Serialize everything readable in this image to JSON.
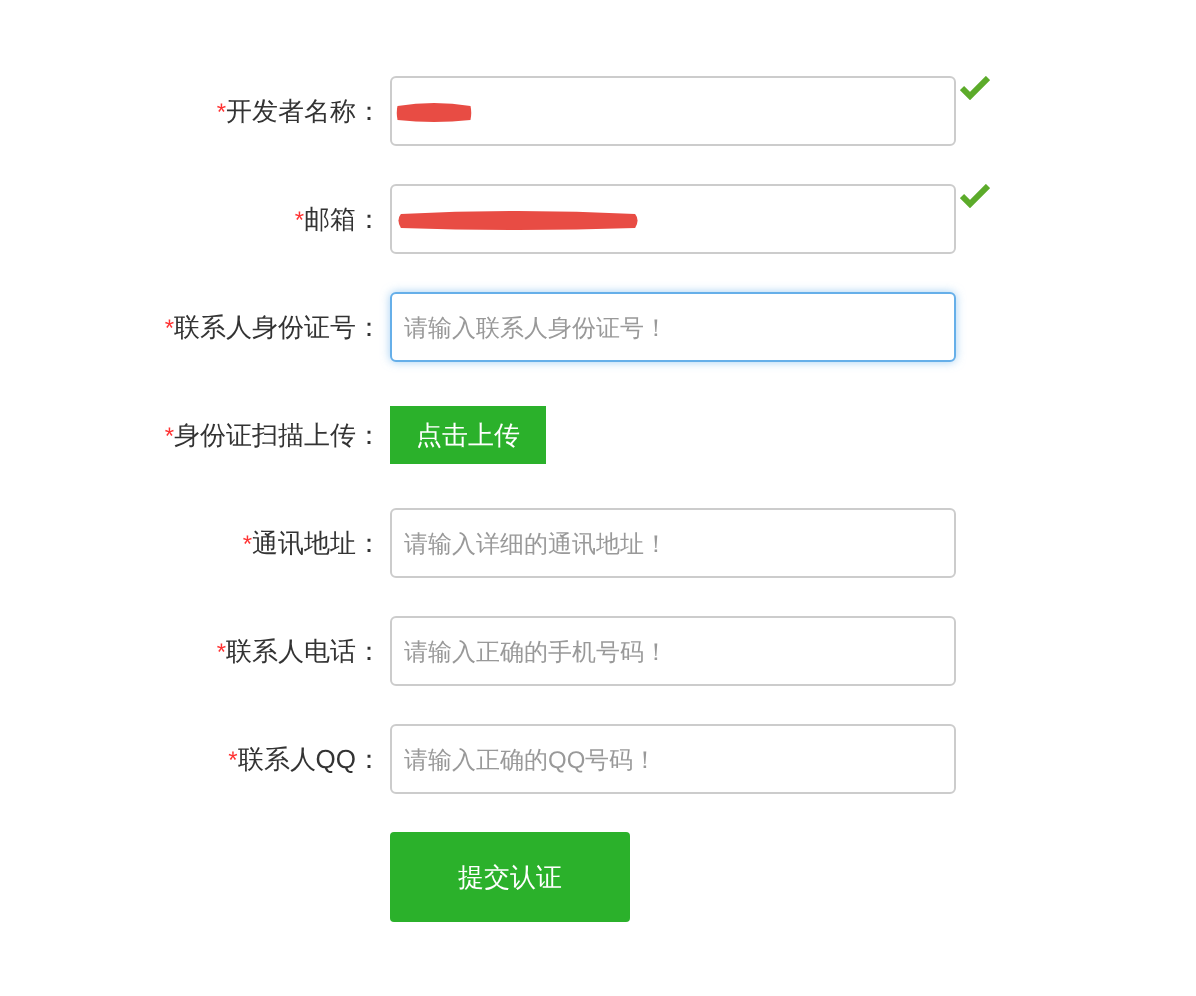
{
  "form": {
    "rows": [
      {
        "label": "开发者名称：",
        "required": true,
        "kind": "redacted",
        "valid": true
      },
      {
        "label": "邮箱：",
        "required": true,
        "kind": "redacted",
        "valid": true
      },
      {
        "label": "联系人身份证号：",
        "required": true,
        "kind": "input",
        "placeholder": "请输入联系人身份证号！",
        "focused": true
      },
      {
        "label": "身份证扫描上传：",
        "required": true,
        "kind": "upload",
        "button": "点击上传"
      },
      {
        "label": "通讯地址：",
        "required": true,
        "kind": "input",
        "placeholder": "请输入详细的通讯地址！",
        "focused": false
      },
      {
        "label": "联系人电话：",
        "required": true,
        "kind": "input",
        "placeholder": "请输入正确的手机号码！",
        "focused": false
      },
      {
        "label": "联系人QQ：",
        "required": true,
        "kind": "input",
        "placeholder": "请输入正确的QQ号码！",
        "focused": false
      }
    ],
    "required_mark": "*",
    "submit": "提交认证"
  }
}
